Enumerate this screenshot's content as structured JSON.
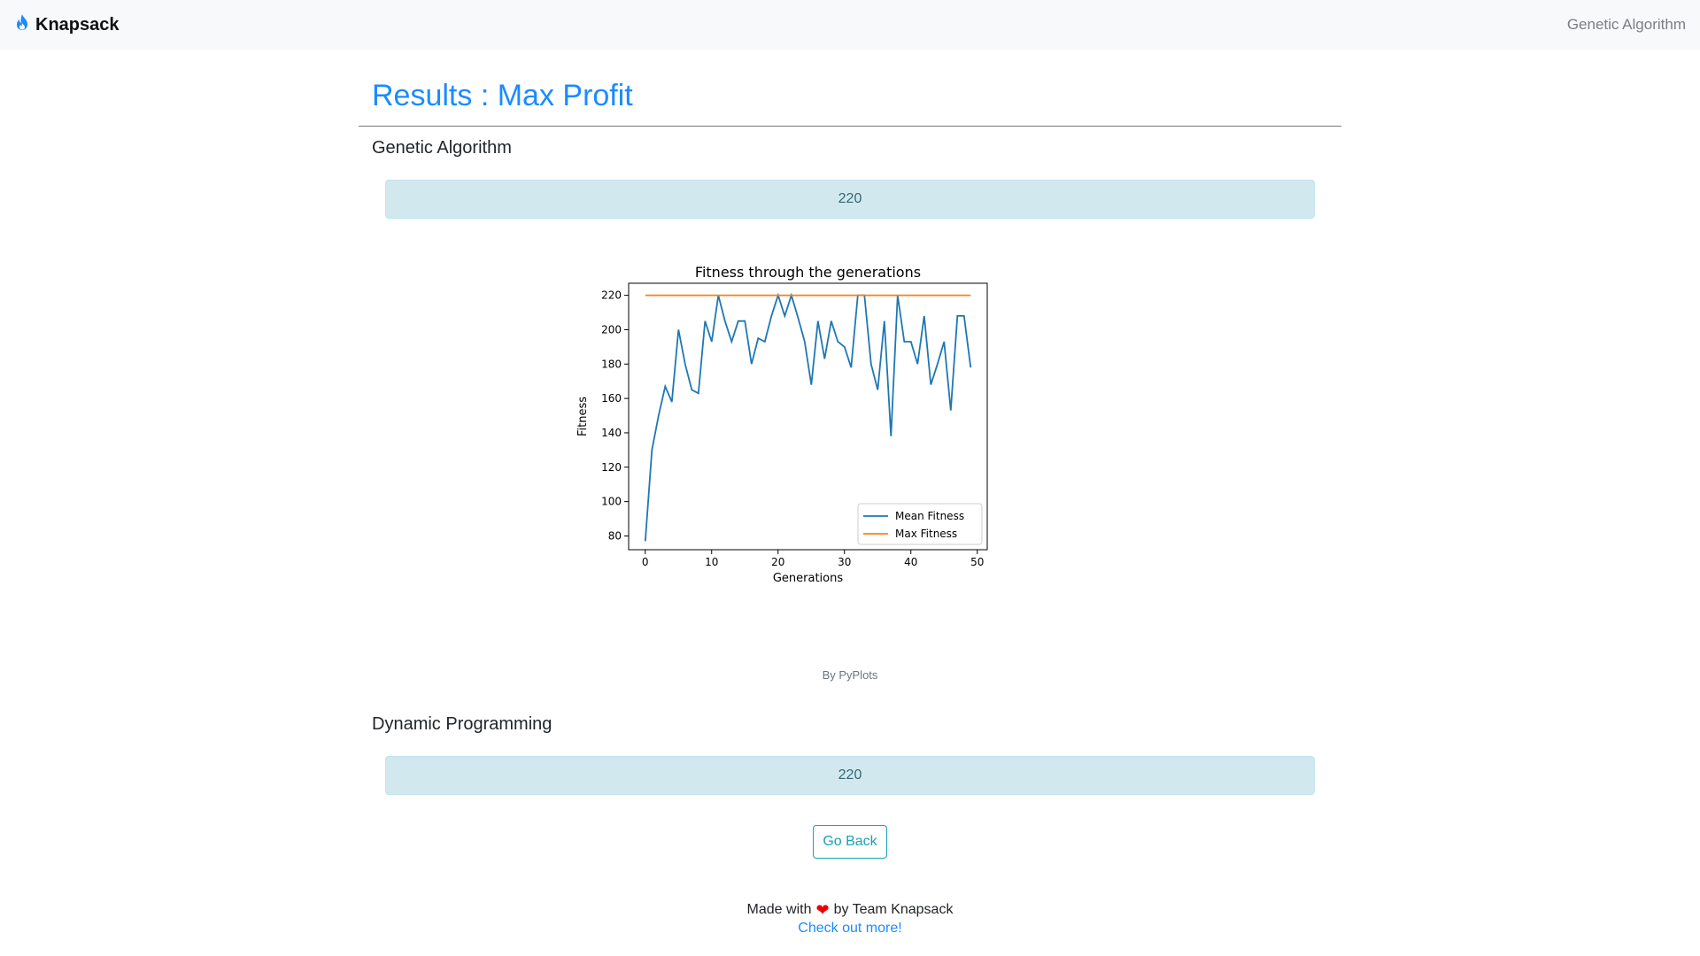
{
  "navbar": {
    "brand": "Knapsack",
    "brand_icon": "fire-icon",
    "nav_link": "Genetic Algorithm"
  },
  "page": {
    "title": "Results : Max Profit"
  },
  "genetic": {
    "heading": "Genetic Algorithm",
    "result": "220"
  },
  "chart_caption": "By PyPlots",
  "dynamic": {
    "heading": "Dynamic Programming",
    "result": "220"
  },
  "buttons": {
    "go_back": "Go Back"
  },
  "footer": {
    "made_with": "Made with",
    "heart_icon": "heart-icon",
    "by_team": "by Team Knapsack",
    "link": "Check out more!"
  },
  "colors": {
    "mean": "#1f77b4",
    "max": "#ff7f0e",
    "title_blue": "#1a8cff",
    "info_bg": "#d1e9ee"
  },
  "chart_data": {
    "type": "line",
    "title": "Fitness through the generations",
    "xlabel": "Generations",
    "ylabel": "Fitness",
    "xlim": [
      0,
      50
    ],
    "ylim": [
      80,
      220
    ],
    "xticks": [
      0,
      10,
      20,
      30,
      40,
      50
    ],
    "yticks": [
      80,
      100,
      120,
      140,
      160,
      180,
      200,
      220
    ],
    "legend_position": "bottom-right",
    "grid": false,
    "series": [
      {
        "name": "Mean Fitness",
        "color": "#1f77b4",
        "x": [
          0,
          1,
          2,
          3,
          4,
          5,
          6,
          7,
          8,
          9,
          10,
          11,
          12,
          13,
          14,
          15,
          16,
          17,
          18,
          19,
          20,
          21,
          22,
          23,
          24,
          25,
          26,
          27,
          28,
          29,
          30,
          31,
          32,
          33,
          34,
          35,
          36,
          37,
          38,
          39,
          40,
          41,
          42,
          43,
          44,
          45,
          46,
          47,
          48,
          49
        ],
        "values": [
          77,
          130,
          150,
          167,
          158,
          200,
          180,
          165,
          163,
          205,
          193,
          220,
          205,
          193,
          205,
          205,
          180,
          195,
          193,
          208,
          220,
          208,
          220,
          207,
          193,
          168,
          205,
          183,
          205,
          193,
          190,
          178,
          220,
          220,
          180,
          165,
          205,
          138,
          220,
          193,
          193,
          180,
          208,
          168,
          180,
          193,
          153,
          208,
          208,
          178
        ]
      },
      {
        "name": "Max Fitness",
        "color": "#ff7f0e",
        "x": [
          0,
          49
        ],
        "values": [
          220,
          220
        ]
      }
    ]
  }
}
